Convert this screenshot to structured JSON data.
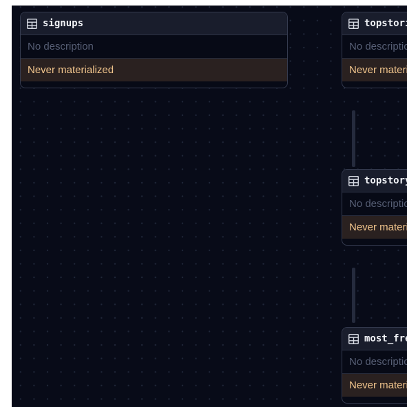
{
  "graph": {
    "nodes": [
      {
        "title": "signups",
        "description": "No description",
        "status": "Never materialized",
        "icon": "table-icon"
      },
      {
        "title": "topstories",
        "description": "No description",
        "status": "Never materialized",
        "icon": "table-icon"
      },
      {
        "title": "topstory_ids",
        "description": "No description",
        "status": "Never materialized",
        "icon": "table-icon"
      },
      {
        "title": "most_frequent_words",
        "description": "No description",
        "status": "Never materialized",
        "icon": "table-icon"
      }
    ]
  },
  "colors": {
    "canvas_background": "#080b18",
    "node_header": "#191d2c",
    "status_background": "#2a2120",
    "status_text": "#f0c48c",
    "description_text": "#565e74"
  }
}
